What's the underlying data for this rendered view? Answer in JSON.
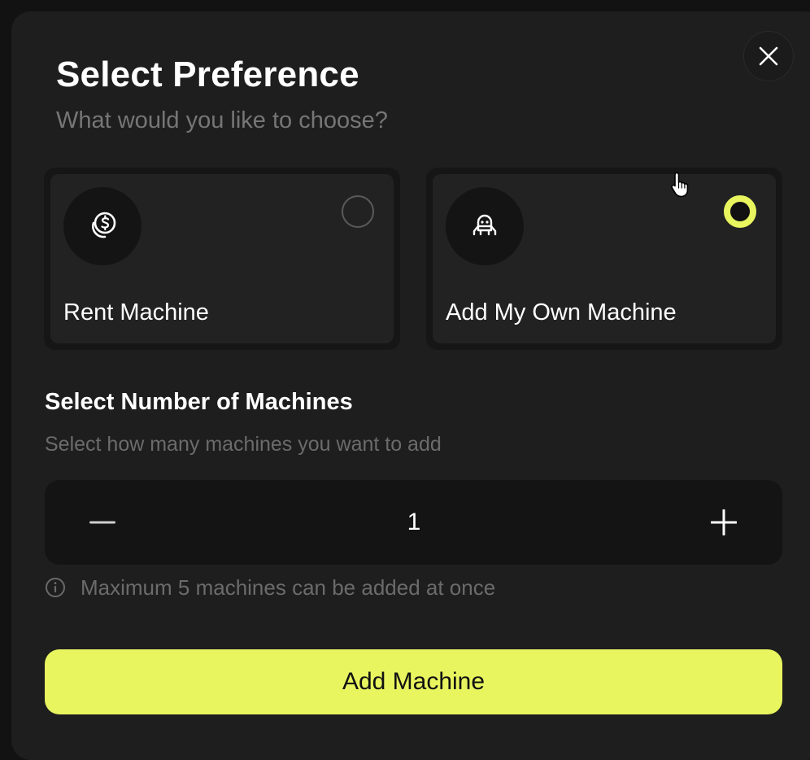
{
  "dialog": {
    "title": "Select Preference",
    "subtitle": "What would you like to choose?",
    "close_icon": "close-icon"
  },
  "options": [
    {
      "label": "Rent Machine",
      "icon": "dollar-coins-icon",
      "selected": false
    },
    {
      "label": "Add My Own Machine",
      "icon": "robot-icon",
      "selected": true
    }
  ],
  "machines": {
    "title": "Select Number of Machines",
    "subtitle": "Select how many machines you want to add",
    "quantity": "1",
    "decrement_icon": "minus-icon",
    "increment_icon": "plus-icon",
    "note": "Maximum 5 machines can be added at once",
    "note_icon": "info-icon"
  },
  "action": {
    "label": "Add Machine"
  },
  "colors": {
    "accent": "#e8f55f",
    "background": "#1e1e1e",
    "card": "#222222",
    "muted_text": "#767676"
  }
}
